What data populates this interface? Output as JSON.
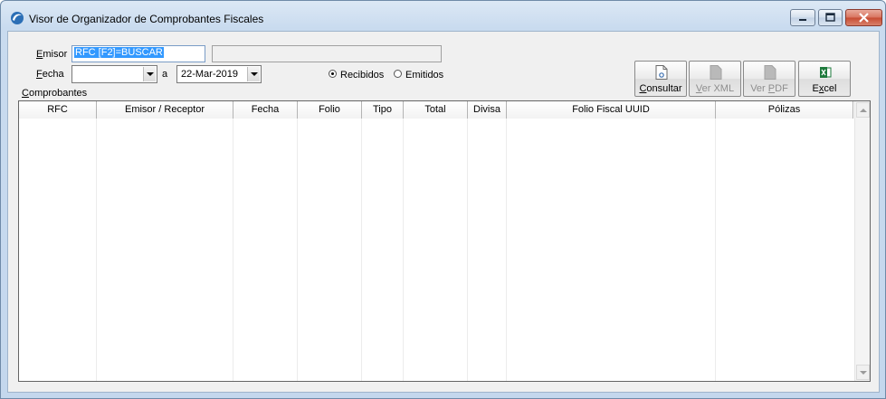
{
  "window": {
    "title": "Visor de Organizador de Comprobantes Fiscales"
  },
  "form": {
    "emisor_label": "Emisor",
    "emisor_value": "RFC [F2]=BUSCAR",
    "emisor_name": "",
    "fecha_label": "Fecha",
    "fecha_from": "",
    "fecha_sep": "a",
    "fecha_to": "22-Mar-2019",
    "radio_recibidos": "Recibidos",
    "radio_emitidos": "Emitidos",
    "selected_radio": "Recibidos",
    "comprobantes_label": "Comprobantes"
  },
  "buttons": {
    "consultar": "Consultar",
    "ver_xml": "Ver XML",
    "ver_pdf": "Ver PDF",
    "excel": "Excel"
  },
  "table": {
    "columns": [
      "RFC",
      "Emisor / Receptor",
      "Fecha",
      "Folio",
      "Tipo",
      "Total",
      "Divisa",
      "Folio Fiscal UUID",
      "Pólizas"
    ],
    "rows": []
  },
  "colors": {
    "selection": "#3399ff",
    "excel_green": "#1e7a3c"
  }
}
